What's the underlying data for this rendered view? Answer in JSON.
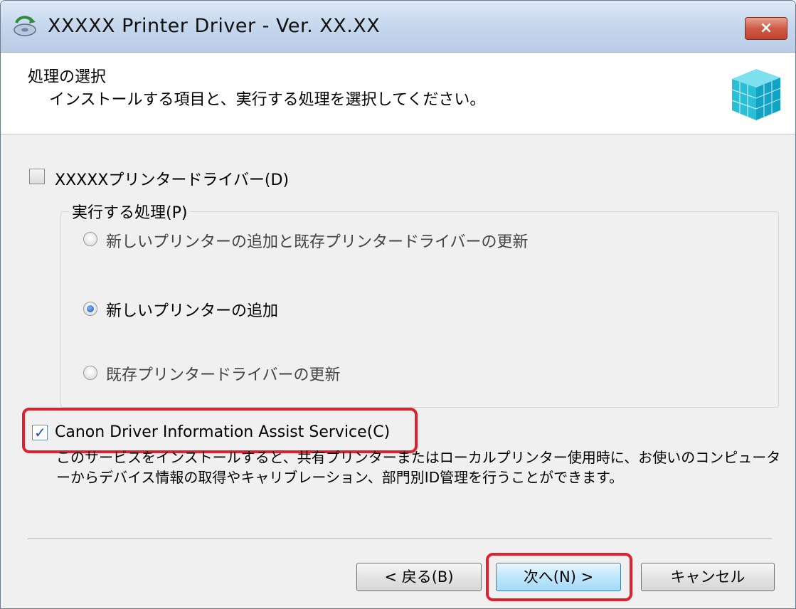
{
  "window": {
    "title": "XXXXX Printer Driver - Ver. XX.XX",
    "close_glyph": "×"
  },
  "header": {
    "title": "処理の選択",
    "subtitle": "インストールする項目と、実行する処理を選択してください。",
    "icon": "cube-icon"
  },
  "options": {
    "driver_checkbox": {
      "label": "XXXXXプリンタードライバー(D)",
      "checked": false
    },
    "process_group": {
      "label": "実行する処理(P)",
      "radios": [
        {
          "label": "新しいプリンターの追加と既存プリンタードライバーの更新",
          "selected": false
        },
        {
          "label": "新しいプリンターの追加",
          "selected": true
        },
        {
          "label": "既存プリンタードライバーの更新",
          "selected": false
        }
      ]
    },
    "assist_checkbox": {
      "label": "Canon Driver Information Assist Service(C)",
      "checked": true
    },
    "assist_description": "このサービスをインストールすると、共有プリンターまたはローカルプリンター使用時に、お使いのコンピューターからデバイス情報の取得やキャリブレーション、部門別ID管理を行うことができます。"
  },
  "buttons": {
    "back": "< 戻る(B)",
    "next": "次へ(N) >",
    "cancel": "キャンセル"
  },
  "highlight_color": "#e0202c"
}
